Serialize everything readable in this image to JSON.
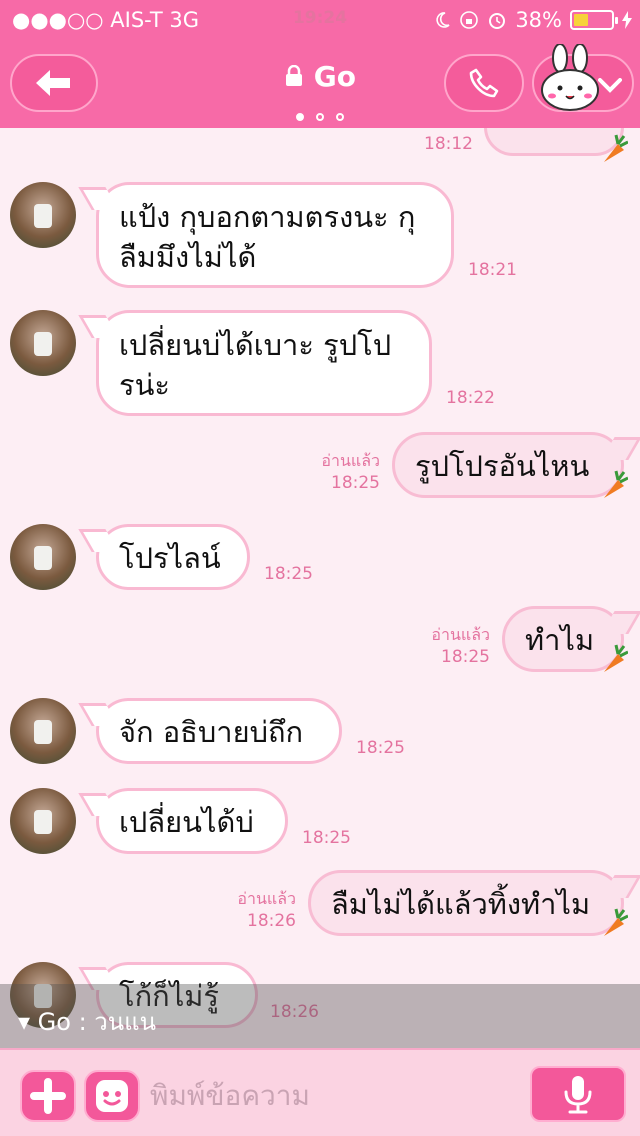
{
  "status": {
    "carrier": "●●●○○ AIS-T   3G",
    "time": "19:24",
    "battery": "38%",
    "battery_level": 0.38
  },
  "header": {
    "title": "Go"
  },
  "messages": [
    {
      "dir": "out",
      "time": "18:12"
    },
    {
      "dir": "in",
      "text": "แป้ง กุบอกตามตรงนะ กุ\nลืมมึงไม่ได้",
      "time": "18:21"
    },
    {
      "dir": "in",
      "text": "เปลี่ยนบ่ได้เบาะ รูปโป\nรน่ะ",
      "time": "18:22"
    },
    {
      "dir": "out",
      "text": "รูปโปรอันไหน",
      "read": "อ่านแล้ว",
      "time": "18:25"
    },
    {
      "dir": "in",
      "text": "โปรไลน์",
      "time": "18:25"
    },
    {
      "dir": "out",
      "text": "ทำไม",
      "read": "อ่านแล้ว",
      "time": "18:25"
    },
    {
      "dir": "in",
      "text": "จัก อธิบายบ่ถึก",
      "time": "18:25"
    },
    {
      "dir": "in",
      "text": "เปลี่ยนได้บ่",
      "time": "18:25"
    },
    {
      "dir": "out",
      "text": "ลืมไม่ได้แล้วทิ้งทำไม",
      "read": "อ่านแล้ว",
      "time": "18:26"
    },
    {
      "dir": "in",
      "text": "โก้ก็ไม่รู้",
      "time": "18:26"
    }
  ],
  "notify": {
    "text": "▾ Go  :  วนแน"
  },
  "input": {
    "placeholder": "พิมพ์ข้อความ"
  },
  "colors": {
    "header": "#f76aa7",
    "chat_bg": "#fdeef4",
    "bubble_border": "#f9b9d2",
    "timestamp": "#e4739f"
  }
}
